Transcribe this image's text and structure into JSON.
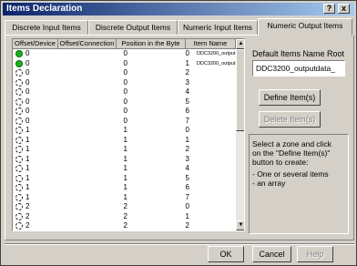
{
  "window": {
    "title": "Items Declaration",
    "help_glyph": "?",
    "close_glyph": "x"
  },
  "tabs": [
    {
      "label": "Discrete Input Items",
      "active": false
    },
    {
      "label": "Discrete Output Items",
      "active": false
    },
    {
      "label": "Numeric Input Items",
      "active": false
    },
    {
      "label": "Numeric Output Items",
      "active": true
    }
  ],
  "grid": {
    "columns": [
      "Offset/Device",
      "Offset/Connection",
      "Position in the Byte",
      "Item Name"
    ],
    "rows": [
      {
        "status": "green",
        "offset_device": "0",
        "offset_connection": "0",
        "position": "0",
        "item": "DDC3200_output"
      },
      {
        "status": "green",
        "offset_device": "0",
        "offset_connection": "0",
        "position": "1",
        "item": "DDC3200_output"
      },
      {
        "status": "empty",
        "offset_device": "0",
        "offset_connection": "0",
        "position": "2",
        "item": ""
      },
      {
        "status": "empty",
        "offset_device": "0",
        "offset_connection": "0",
        "position": "3",
        "item": ""
      },
      {
        "status": "empty",
        "offset_device": "0",
        "offset_connection": "0",
        "position": "4",
        "item": ""
      },
      {
        "status": "empty",
        "offset_device": "0",
        "offset_connection": "0",
        "position": "5",
        "item": ""
      },
      {
        "status": "empty",
        "offset_device": "0",
        "offset_connection": "0",
        "position": "6",
        "item": ""
      },
      {
        "status": "empty",
        "offset_device": "0",
        "offset_connection": "0",
        "position": "7",
        "item": ""
      },
      {
        "status": "empty",
        "offset_device": "1",
        "offset_connection": "1",
        "position": "0",
        "item": ""
      },
      {
        "status": "empty",
        "offset_device": "1",
        "offset_connection": "1",
        "position": "1",
        "item": ""
      },
      {
        "status": "empty",
        "offset_device": "1",
        "offset_connection": "1",
        "position": "2",
        "item": ""
      },
      {
        "status": "empty",
        "offset_device": "1",
        "offset_connection": "1",
        "position": "3",
        "item": ""
      },
      {
        "status": "empty",
        "offset_device": "1",
        "offset_connection": "1",
        "position": "4",
        "item": ""
      },
      {
        "status": "empty",
        "offset_device": "1",
        "offset_connection": "1",
        "position": "5",
        "item": ""
      },
      {
        "status": "empty",
        "offset_device": "1",
        "offset_connection": "1",
        "position": "6",
        "item": ""
      },
      {
        "status": "empty",
        "offset_device": "1",
        "offset_connection": "1",
        "position": "7",
        "item": ""
      },
      {
        "status": "empty",
        "offset_device": "2",
        "offset_connection": "2",
        "position": "0",
        "item": ""
      },
      {
        "status": "empty",
        "offset_device": "2",
        "offset_connection": "2",
        "position": "1",
        "item": ""
      },
      {
        "status": "empty",
        "offset_device": "2",
        "offset_connection": "2",
        "position": "2",
        "item": ""
      }
    ]
  },
  "right_panel": {
    "root_label": "Default Items Name Root",
    "root_value": "DDC3200_outputdata_",
    "define_button": "Define Item(s)",
    "delete_button": "Delete Item(s)",
    "info_lines": [
      "Select a zone and click",
      "on the \"Define Item(s)\"",
      "button to create:",
      "- One or several items",
      "- an array"
    ]
  },
  "footer": {
    "ok": "OK",
    "cancel": "Cancel",
    "help": "Help"
  },
  "colors": {
    "face": "#d4d0c8",
    "title_start": "#0a246a",
    "title_end": "#a6caf0",
    "status_green": "#19b419"
  }
}
